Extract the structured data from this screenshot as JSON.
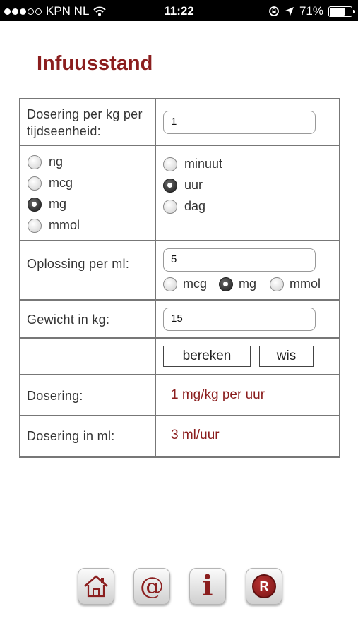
{
  "status_bar": {
    "carrier": "KPN NL",
    "time": "11:22",
    "battery": "71%",
    "battery_level": 0.71
  },
  "page": {
    "title": "Infuusstand"
  },
  "form": {
    "dose_label": "Dosering per kg per tijdseenheid:",
    "dose_value": "1",
    "unit_options": [
      "ng",
      "mcg",
      "mg",
      "mmol"
    ],
    "unit_selected": "mg",
    "time_options": [
      "minuut",
      "uur",
      "dag"
    ],
    "time_selected": "uur",
    "solution_label": "Oplossing per ml:",
    "solution_value": "5",
    "solution_unit_options": [
      "mcg",
      "mg",
      "mmol"
    ],
    "solution_unit_selected": "mg",
    "weight_label": "Gewicht in kg:",
    "weight_value": "15",
    "calculate_label": "bereken",
    "clear_label": "wis",
    "dosage_label": "Dosering:",
    "dosage_result": "1 mg/kg per uur",
    "dosage_ml_label": "Dosering in ml:",
    "dosage_ml_result": "3 ml/uur"
  },
  "toolbar": {
    "items": [
      {
        "icon": "home-icon"
      },
      {
        "icon": "at-icon"
      },
      {
        "icon": "info-icon"
      },
      {
        "icon": "registered-icon",
        "glyph": "R"
      }
    ],
    "info_glyph": "i",
    "at_glyph": "@"
  },
  "colors": {
    "accent": "#8b1e1e",
    "border": "#777777"
  }
}
